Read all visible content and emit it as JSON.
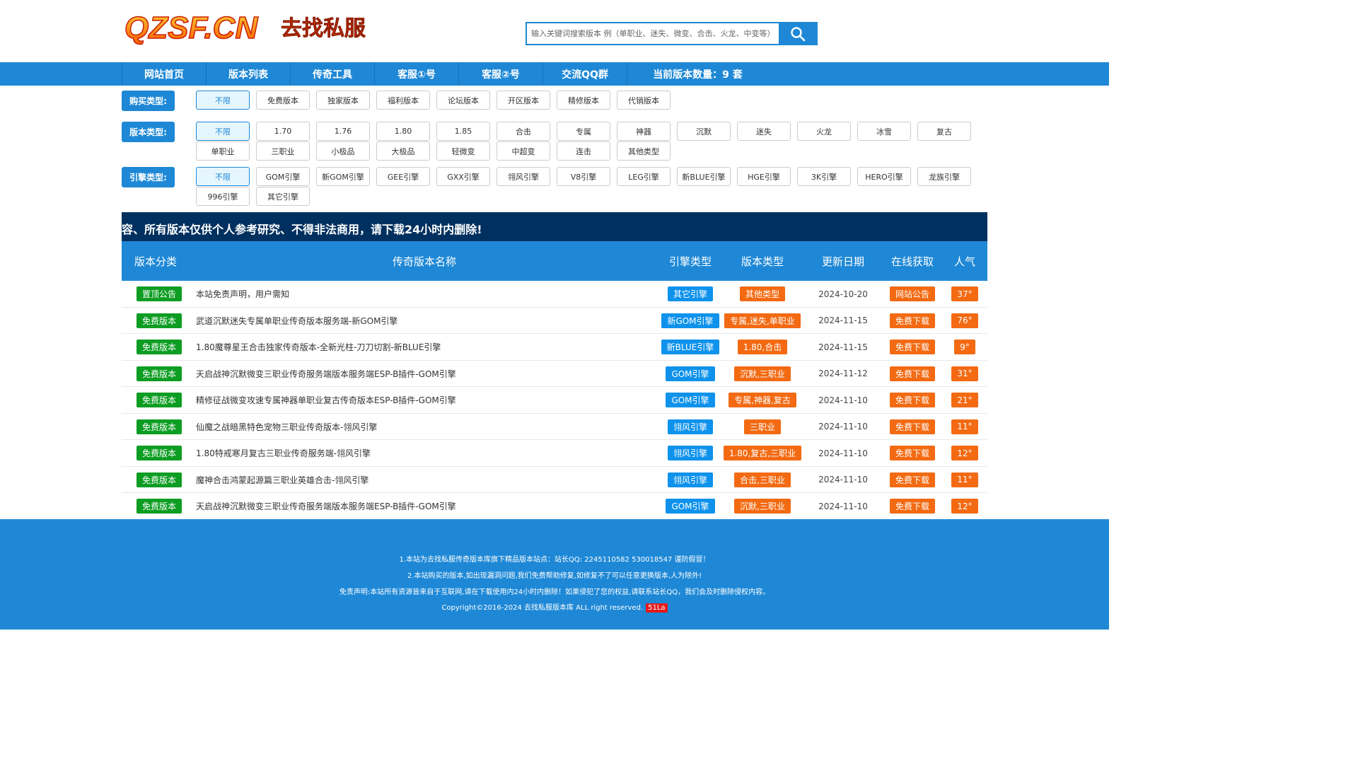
{
  "logo": {
    "text": "QZSF.CN",
    "subtext": "去找私服"
  },
  "search": {
    "placeholder": "输入关键词搜索版本 例（单职业、迷失、微变、合击、火龙、中变等）"
  },
  "nav": {
    "items": [
      "网站首页",
      "版本列表",
      "传奇工具",
      "客服①号",
      "客服②号",
      "交流QQ群"
    ],
    "count_text": "当前版本数量：9 套"
  },
  "filters": {
    "buy": {
      "label": "购买类型:",
      "options": [
        "不限",
        "免费版本",
        "独家版本",
        "福利版本",
        "论坛版本",
        "开区版本",
        "精修版本",
        "代销版本"
      ]
    },
    "version": {
      "label": "版本类型:",
      "options": [
        "不限",
        "1.70",
        "1.76",
        "1.80",
        "1.85",
        "合击",
        "专属",
        "神器",
        "沉默",
        "迷失",
        "火龙",
        "冰雪",
        "复古",
        "单职业",
        "三职业",
        "小极品",
        "大极品",
        "轻微变",
        "中超变",
        "连击",
        "其他类型"
      ]
    },
    "engine": {
      "label": "引擎类型:",
      "options": [
        "不限",
        "GOM引擎",
        "新GOM引擎",
        "GEE引擎",
        "GXX引擎",
        "翎风引擎",
        "V8引擎",
        "LEG引擎",
        "新BLUE引擎",
        "HGE引擎",
        "3K引擎",
        "HERO引擎",
        "龙族引擎",
        "996引擎",
        "其它引擎"
      ]
    }
  },
  "notice": "容、所有版本仅供个人参考研究、不得非法商用，请下载24小时内删除!",
  "table": {
    "headers": [
      "版本分类",
      "传奇版本名称",
      "引擎类型",
      "版本类型",
      "更新日期",
      "在线获取",
      "人气"
    ],
    "rows": [
      {
        "category": "置顶公告",
        "name": "本站免责声明，用户需知",
        "engine": "其它引擎",
        "vtype": "其他类型",
        "date": "2024-10-20",
        "action": "网站公告",
        "hot": "37°"
      },
      {
        "category": "免费版本",
        "name": "武道沉默迷失专属单职业传奇版本服务端-新GOM引擎",
        "engine": "新GOM引擎",
        "vtype": "专属,迷失,单职业",
        "date": "2024-11-15",
        "action": "免费下载",
        "hot": "76°"
      },
      {
        "category": "免费版本",
        "name": "1.80魔尊星王合击独家传奇版本-全新光柱-刀刀切割-新BLUE引擎",
        "engine": "新BLUE引擎",
        "vtype": "1.80,合击",
        "date": "2024-11-15",
        "action": "免费下载",
        "hot": "9°"
      },
      {
        "category": "免费版本",
        "name": "天启战神沉默微变三职业传奇服务端版本服务端ESP-B插件-GOM引擎",
        "engine": "GOM引擎",
        "vtype": "沉默,三职业",
        "date": "2024-11-12",
        "action": "免费下载",
        "hot": "31°"
      },
      {
        "category": "免费版本",
        "name": "精修征战微变攻速专属神器单职业复古传奇版本ESP-B插件-GOM引擎",
        "engine": "GOM引擎",
        "vtype": "专属,神器,复古",
        "date": "2024-11-10",
        "action": "免费下载",
        "hot": "21°"
      },
      {
        "category": "免费版本",
        "name": "仙魔之战暗黑特色宠物三职业传奇版本-翎风引擎",
        "engine": "翎风引擎",
        "vtype": "三职业",
        "date": "2024-11-10",
        "action": "免费下载",
        "hot": "11°"
      },
      {
        "category": "免费版本",
        "name": "1.80特戒寒月复古三职业传奇服务端-翎风引擎",
        "engine": "翎风引擎",
        "vtype": "1.80,复古,三职业",
        "date": "2024-11-10",
        "action": "免费下载",
        "hot": "12°"
      },
      {
        "category": "免费版本",
        "name": "魔神合击鸿蒙起源篇三职业英雄合击-翎风引擎",
        "engine": "翎风引擎",
        "vtype": "合击,三职业",
        "date": "2024-11-10",
        "action": "免费下载",
        "hot": "11°"
      },
      {
        "category": "免费版本",
        "name": "天启战神沉默微变三职业传奇服务端版本服务端ESP-B插件-GOM引擎",
        "engine": "GOM引擎",
        "vtype": "沉默,三职业",
        "date": "2024-11-10",
        "action": "免费下载",
        "hot": "12°"
      }
    ]
  },
  "footer": {
    "line1": "1.本站为去找私服传奇版本库旗下精品版本站点：站长QQ: 2245110582 530018547 谨防假冒！",
    "line2": "2.本站购买的版本,如出现漏洞问题,我们免费帮助修复,如修复不了可以任意更换版本,人为除外!",
    "line3": "免责声明:本站所有资源皆来自于互联网,请在下载使用内24小时内删除！如果侵犯了您的权益,请联系站长QQ，我们会及时删除侵权内容。",
    "copyright": "Copyright©2016-2024 去找私服版本库 ALL right reserved.",
    "stat_badge": "51La"
  },
  "colors": {
    "brand_blue": "#1e88d6",
    "notice_bg": "#00305f",
    "green": "#0d9d22",
    "blue_badge": "#0e92ec",
    "orange": "#f36a12"
  }
}
